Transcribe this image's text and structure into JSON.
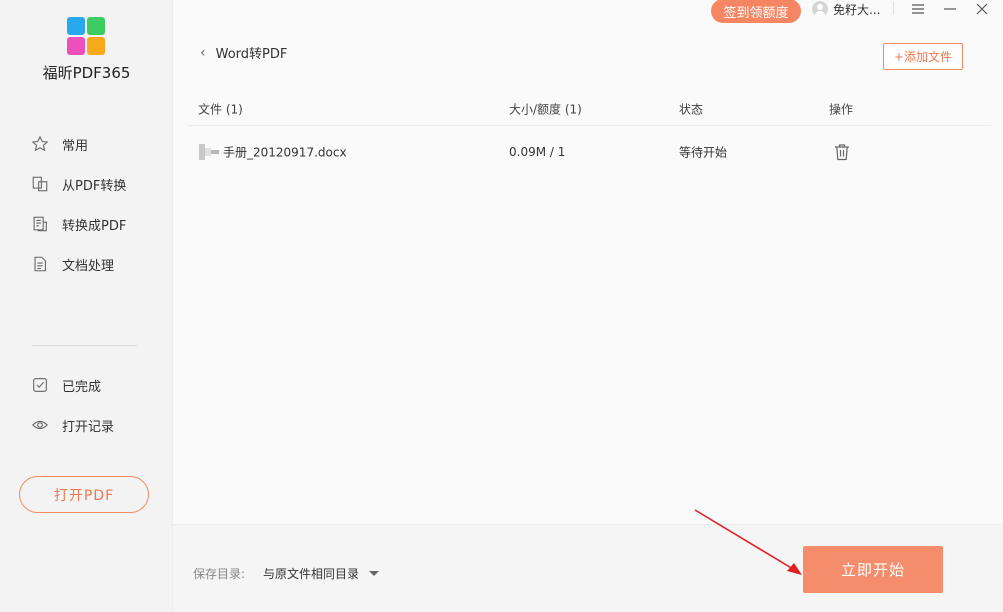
{
  "app": {
    "name": "福昕PDF365"
  },
  "topbar": {
    "signin_label": "签到领额度",
    "user_name": "免籽大..."
  },
  "sidebar": {
    "items": [
      {
        "label": "常用",
        "icon": "star-icon"
      },
      {
        "label": "从PDF转换",
        "icon": "from-pdf-icon"
      },
      {
        "label": "转换成PDF",
        "icon": "to-pdf-icon"
      },
      {
        "label": "文档处理",
        "icon": "document-icon"
      }
    ],
    "bottom_items": [
      {
        "label": "已完成",
        "icon": "check-box-icon"
      },
      {
        "label": "打开记录",
        "icon": "eye-icon"
      }
    ],
    "open_pdf_label": "打开PDF"
  },
  "main": {
    "back_label": "Word转PDF",
    "add_file_label": "+添加文件",
    "columns": {
      "file": "文件 (1)",
      "size": "大小/额度 (1)",
      "status": "状态",
      "action": "操作"
    },
    "rows": [
      {
        "name": "手册_20120917.docx",
        "size": "0.09M / 1",
        "status": "等待开始"
      }
    ]
  },
  "footer": {
    "save_label": "保存目录:",
    "save_value": "与原文件相同目录",
    "start_label": "立即开始"
  },
  "colors": {
    "accent": "#f58c6c",
    "accent_text": "#f0784e",
    "annotation": "#e02020"
  }
}
